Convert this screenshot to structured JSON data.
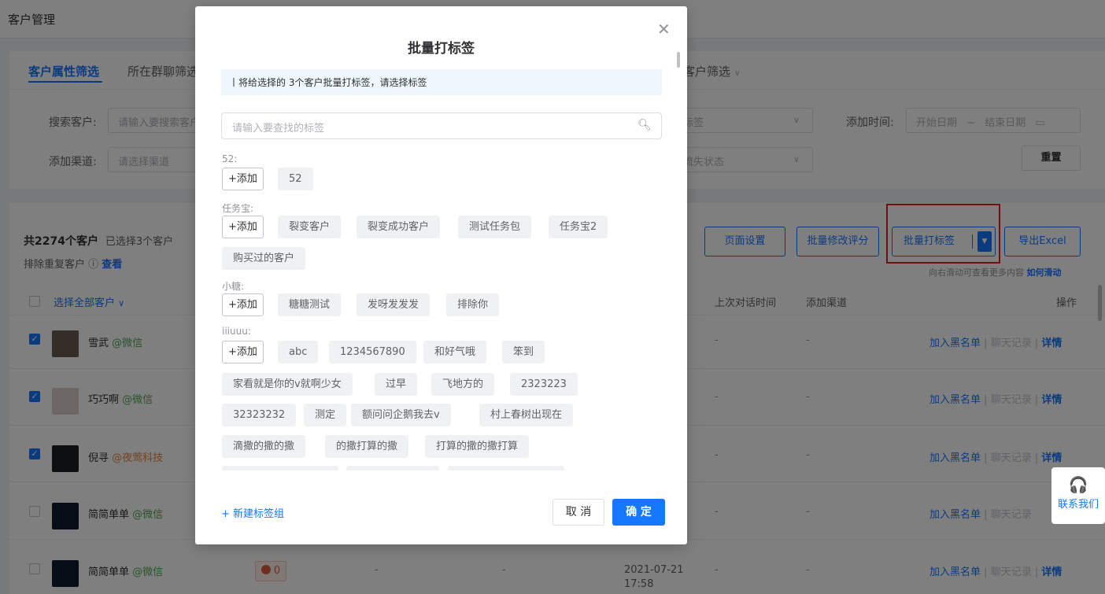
{
  "page": {
    "title": "客户管理"
  },
  "filters": {
    "tabs": [
      "客户属性筛选",
      "所在群聊筛选",
      "客户筛选"
    ],
    "search_label": "搜索客户:",
    "search_placeholder": "请输入要搜索客户",
    "channel_label": "添加渠道:",
    "channel_placeholder": "请选择渠道",
    "tag_placeholder": "标签",
    "lost_placeholder": "流失状态",
    "time_label": "添加时间:",
    "start_date": "开始日期",
    "date_sep": "~",
    "end_date": "结束日期",
    "reset": "重置"
  },
  "list": {
    "total_prefix": "共2274个客户",
    "selected": "已选择3个客户",
    "dedup": "排除重复客户 ⓘ",
    "dedup_link": "查看",
    "buttons": {
      "page_settings": "页面设置",
      "batch_rating": "批量修改评分",
      "batch_tag": "批量打标签",
      "export": "导出Excel"
    },
    "scroll_hint": "向右滑动可查看更多内容",
    "scroll_link": "如何滑动",
    "columns": {
      "select_all": "选择全部客户",
      "last_chat": "上次对话时间",
      "channel": "添加渠道",
      "ops": "操作"
    },
    "rows": [
      {
        "name": "雪武",
        "source": "@微信",
        "last_chat": "-",
        "channel": "-"
      },
      {
        "name": "巧巧啊",
        "source": "@微信",
        "last_chat": "-",
        "channel": "-"
      },
      {
        "name": "倪寻",
        "source": "@夜莺科技",
        "last_chat": "-",
        "channel": "-"
      },
      {
        "name": "简简单单",
        "source": "@微信",
        "last_chat": "-",
        "channel": "-"
      },
      {
        "name": "简简单单",
        "source": "@微信",
        "last_chat": "-",
        "channel": "-",
        "score": "0",
        "col_a": "-",
        "col_b": "-",
        "date": "2021-07-21",
        "time": "17:58"
      }
    ],
    "ops": {
      "blacklist": "加入黑名单",
      "chat": "聊天记录",
      "detail": "详情",
      "sep": "|"
    }
  },
  "contact": {
    "label": "联系我们"
  },
  "modal": {
    "title": "批量打标签",
    "notice": "丨将给选择的 3个客户批量打标签，请选择标签",
    "search_placeholder": "请输入要查找的标签",
    "add_label": "+添加",
    "groups": [
      {
        "name": "52:",
        "tags": [
          "52"
        ]
      },
      {
        "name": "任务宝:",
        "tags": [
          "裂变客户",
          "裂变成功客户",
          "测试任务包",
          "任务宝2",
          "购买过的客户"
        ]
      },
      {
        "name": "小糖:",
        "tags": [
          "糖糖测试",
          "发呀发发发",
          "排除你"
        ]
      },
      {
        "name": "iiiuuu:",
        "tags": [
          "abc",
          "1234567890",
          "和好气哦",
          "笨到",
          "家看就是你的v就啊少女",
          "过早",
          "飞地方的",
          "2323223",
          "32323232",
          "测定",
          "额问问企鹅我去v",
          "村上春树出现在",
          "滴撒的撒的撒",
          "的撒打算的撒",
          "打算的撒的撒打算"
        ]
      }
    ],
    "new_group": "+ 新建标签组",
    "cancel": "取 消",
    "ok": "确 定"
  },
  "colors": {
    "primary": "#1677ff",
    "highlight_box": "#e02020",
    "overlay": "rgba(0,0,0,0.5)"
  }
}
